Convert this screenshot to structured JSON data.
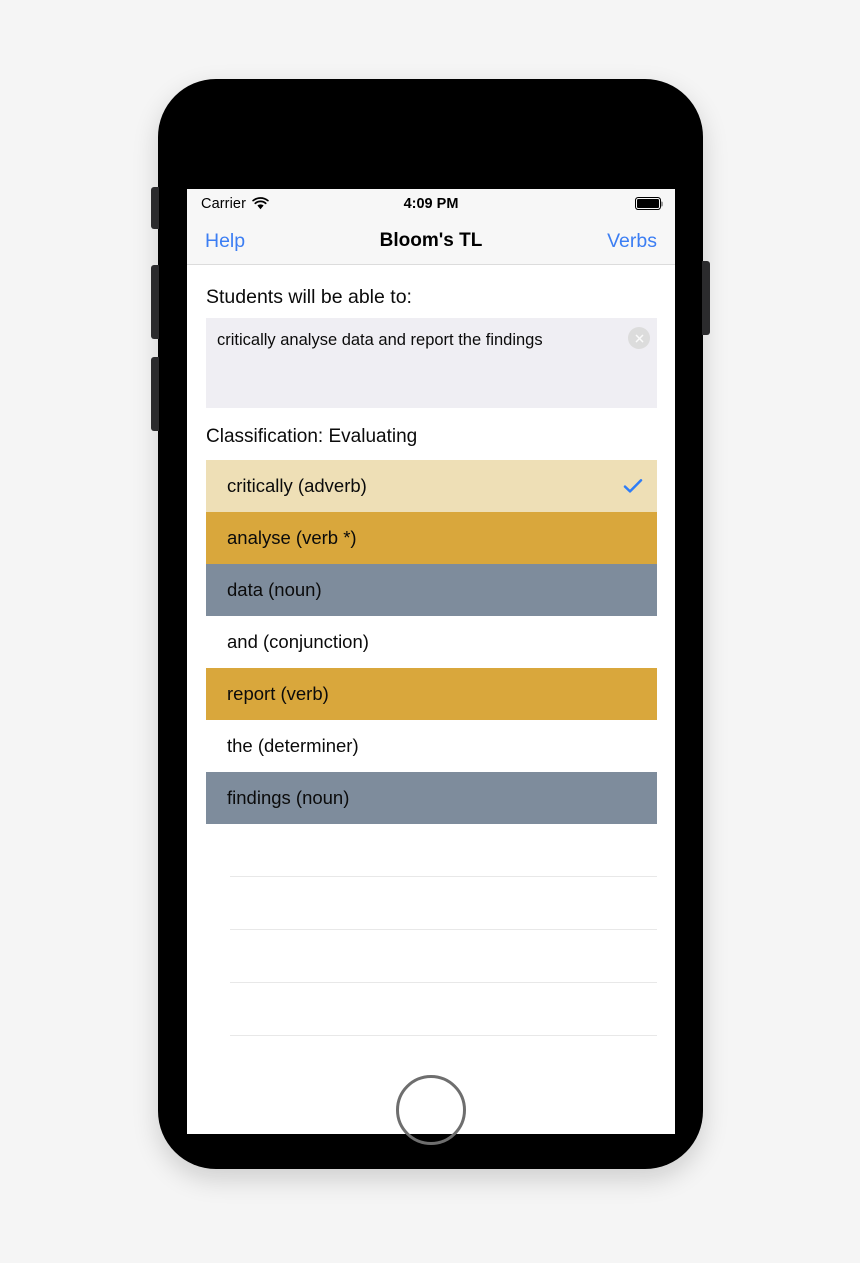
{
  "status_bar": {
    "carrier": "Carrier",
    "wifi_icon": "wifi-icon",
    "time": "4:09 PM",
    "battery_icon": "battery-full-icon",
    "battery_level_percent": 100
  },
  "nav_bar": {
    "left_button": "Help",
    "title": "Bloom's TL",
    "right_button": "Verbs"
  },
  "main": {
    "prompt_label": "Students will be able to:",
    "objective_input": {
      "value": "critically analyse data and report the findings",
      "placeholder": "",
      "clear_icon": "clear-circle-icon"
    },
    "classification_label": "Classification: Evaluating",
    "tokens": [
      {
        "label": "critically (adverb)",
        "pos": "adverb",
        "color": "#eedfb6",
        "selected": true,
        "check_icon": "checkmark-icon"
      },
      {
        "label": "analyse (verb *)",
        "pos": "verb",
        "color": "#d9a73c",
        "selected": false,
        "check_icon": ""
      },
      {
        "label": "data (noun)",
        "pos": "noun",
        "color": "#7e8c9c",
        "selected": false,
        "check_icon": ""
      },
      {
        "label": "and (conjunction)",
        "pos": "conjunction",
        "color": "#ffffff",
        "selected": false,
        "check_icon": ""
      },
      {
        "label": "report (verb)",
        "pos": "verb",
        "color": "#d9a73c",
        "selected": false,
        "check_icon": ""
      },
      {
        "label": "the (determiner)",
        "pos": "determiner",
        "color": "#ffffff",
        "selected": false,
        "check_icon": ""
      },
      {
        "label": "findings (noun)",
        "pos": "noun",
        "color": "#7e8c9c",
        "selected": false,
        "check_icon": ""
      }
    ],
    "empty_row_count": 4
  },
  "hardware": {
    "silent_switch": "silent-switch",
    "volume_up": "volume-up-button",
    "volume_down": "volume-down-button",
    "power": "power-button",
    "home": "home-button"
  },
  "colors": {
    "accent_blue": "#3c7ef3",
    "checkmark_blue": "#2f7df6",
    "adverb_tan": "#eedfb6",
    "verb_gold": "#d9a73c",
    "noun_slate": "#7e8c9c",
    "input_bg": "#efeef3",
    "page_bg": "#f5f5f5"
  }
}
